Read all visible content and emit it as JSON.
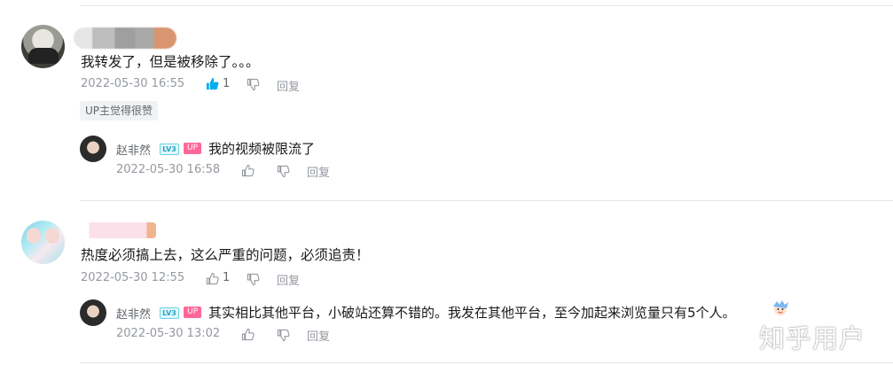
{
  "comments": [
    {
      "content": "我转发了，但是被移除了。。。",
      "time": "2022-05-30 16:55",
      "like_count": "1",
      "reply_label": "回复",
      "up_badge": "UP主觉得很赞",
      "replies": [
        {
          "username": "赵非然",
          "level": "LV3",
          "up_tag": "UP",
          "content": "我的视频被限流了",
          "time": "2022-05-30 16:58",
          "reply_label": "回复"
        }
      ]
    },
    {
      "content": "热度必须搞上去，这么严重的问题，必须追责！",
      "time": "2022-05-30 12:55",
      "like_count": "1",
      "reply_label": "回复",
      "replies": [
        {
          "username": "赵非然",
          "level": "LV3",
          "up_tag": "UP",
          "content": "其实相比其他平台，小破站还算不错的。我发在其他平台，至今加起来浏览量只有5个人。",
          "time": "2022-05-30 13:02",
          "reply_label": "回复"
        }
      ]
    }
  ],
  "watermark": "知乎用户",
  "colors": {
    "text": "#18191c",
    "meta": "#9499a0",
    "like_active": "#00aeec",
    "up_pink": "#ff6699",
    "divider": "#e3e5e7"
  },
  "icons": [
    "like-icon",
    "dislike-icon",
    "emoji-sticker"
  ]
}
